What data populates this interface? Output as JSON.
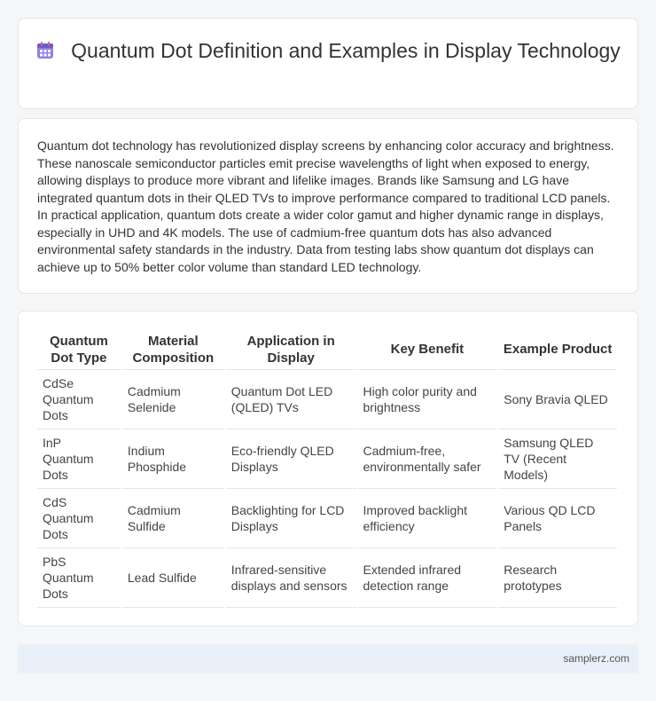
{
  "header": {
    "title": "Quantum Dot Definition and Examples in Display Technology",
    "icon": "calendar-icon",
    "icon_color": "#7b6cd9"
  },
  "intro": {
    "text": "Quantum dot technology has revolutionized display screens by enhancing color accuracy and brightness. These nanoscale semiconductor particles emit precise wavelengths of light when exposed to energy, allowing displays to produce more vibrant and lifelike images. Brands like Samsung and LG have integrated quantum dots in their QLED TVs to improve performance compared to traditional LCD panels. In practical application, quantum dots create a wider color gamut and higher dynamic range in displays, especially in UHD and 4K models. The use of cadmium-free quantum dots has also advanced environmental safety standards in the industry. Data from testing labs show quantum dot displays can achieve up to 50% better color volume than standard LED technology."
  },
  "table": {
    "headers": [
      "Quantum Dot Type",
      "Material Composition",
      "Application in Display",
      "Key Benefit",
      "Example Product"
    ],
    "rows": [
      [
        "CdSe Quantum Dots",
        "Cadmium Selenide",
        "Quantum Dot LED (QLED) TVs",
        "High color purity and brightness",
        "Sony Bravia QLED"
      ],
      [
        "InP Quantum Dots",
        "Indium Phosphide",
        "Eco-friendly QLED Displays",
        "Cadmium-free, environmentally safer",
        "Samsung QLED TV (Recent Models)"
      ],
      [
        "CdS Quantum Dots",
        "Cadmium Sulfide",
        "Backlighting for LCD Displays",
        "Improved backlight efficiency",
        "Various QD LCD Panels"
      ],
      [
        "PbS Quantum Dots",
        "Lead Sulfide",
        "Infrared-sensitive displays and sensors",
        "Extended infrared detection range",
        "Research prototypes"
      ]
    ]
  },
  "footer": {
    "site": "samplerz.com"
  }
}
